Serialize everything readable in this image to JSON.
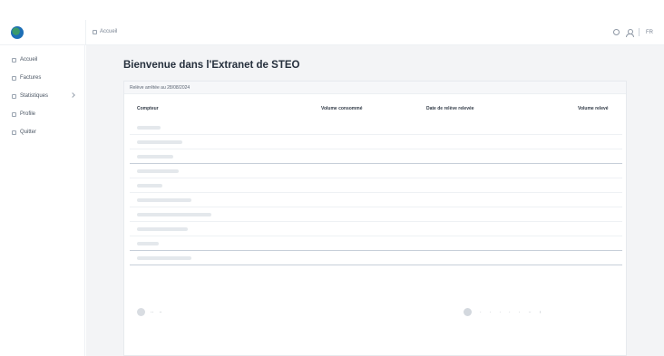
{
  "brand": {
    "logo_text": ""
  },
  "topbar": {
    "breadcrumb": "Accueil",
    "lang": "FR"
  },
  "sidebar": {
    "items": [
      {
        "label": "Accueil",
        "icon": "home-icon"
      },
      {
        "label": "Factures",
        "icon": "invoice-icon"
      },
      {
        "label": "Statistiques",
        "icon": "chart-icon",
        "has_chevron": true
      },
      {
        "label": "Profile",
        "icon": "profile-icon"
      },
      {
        "label": "Quitter",
        "icon": "logout-icon"
      }
    ]
  },
  "page": {
    "title": "Bienvenue dans l'Extranet de STEO"
  },
  "card": {
    "header": "Relève arrêtée au 28/08/2024",
    "columns": [
      "Compteur",
      "Volume consommé",
      "Date de relève relevée",
      "Volume relevé"
    ],
    "rows": [
      {
        "col2": "",
        "col3": "",
        "col4": "",
        "emph": false
      },
      {
        "col2": "",
        "col3": "",
        "col4": "",
        "emph": false
      },
      {
        "col2": "",
        "col3": "",
        "col4": "",
        "emph": true
      },
      {
        "col2": "",
        "col3": "",
        "col4": "",
        "emph": false
      },
      {
        "col2": "",
        "col3": "",
        "col4": "",
        "emph": false
      },
      {
        "col2": "",
        "col3": "",
        "col4": "",
        "emph": false
      },
      {
        "col2": "",
        "col3": "",
        "col4": "",
        "emph": false
      },
      {
        "col2": "",
        "col3": "",
        "col4": "",
        "emph": false
      },
      {
        "col2": "",
        "col3": "",
        "col4": "",
        "emph": true
      },
      {
        "col2": "",
        "col3": "",
        "col4": "",
        "emph": true
      }
    ],
    "footnote_lines": [
      "",
      "",
      ""
    ]
  },
  "colors": {
    "accent": "#2a6aa8",
    "background": "#f3f4f6"
  }
}
